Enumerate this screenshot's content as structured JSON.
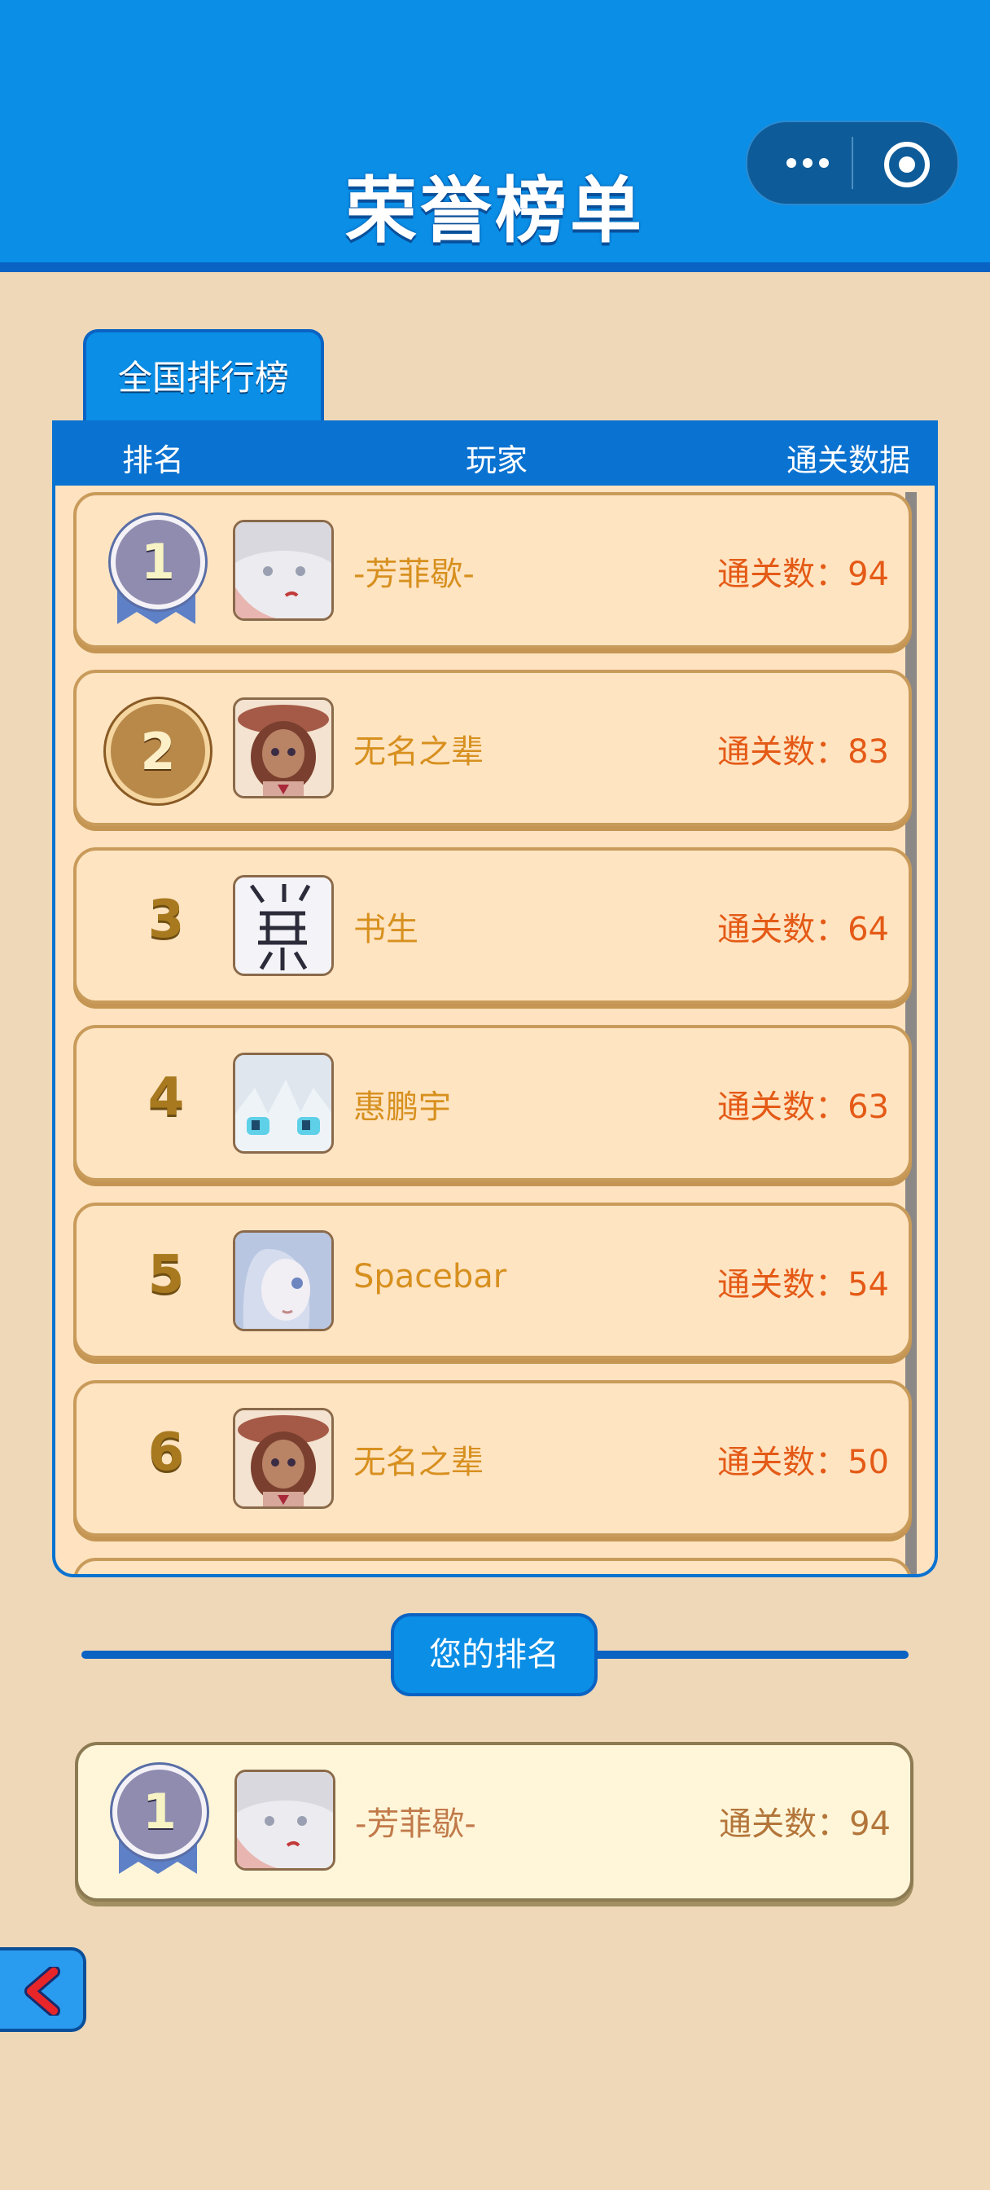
{
  "header": {
    "title": "荣誉榜单"
  },
  "tabs": [
    {
      "label": "全国排行榜"
    }
  ],
  "columns": {
    "rank": "排名",
    "player": "玩家",
    "data": "通关数据"
  },
  "leaderboard": [
    {
      "rank": "1",
      "name": "-芳菲歇-",
      "score": "通关数：94",
      "medal": "silver-ribbon-medal",
      "avatar": "avatar-white-hair"
    },
    {
      "rank": "2",
      "name": "无名之辈",
      "score": "通关数：83",
      "medal": "bronze-medal",
      "avatar": "avatar-girl-hat"
    },
    {
      "rank": "3",
      "name": "书生",
      "score": "通关数：64",
      "avatar": "avatar-calligraphy"
    },
    {
      "rank": "4",
      "name": "惠鹏宇",
      "score": "通关数：63",
      "avatar": "avatar-blue-eyes"
    },
    {
      "rank": "5",
      "name": "Spacebar",
      "score": "通关数：54",
      "avatar": "avatar-pale-girl"
    },
    {
      "rank": "6",
      "name": "无名之辈",
      "score": "通关数：50",
      "avatar": "avatar-girl-hat"
    }
  ],
  "my_rank_section": {
    "label": "您的排名",
    "entry": {
      "rank": "1",
      "name": "-芳菲歇-",
      "score": "通关数：94",
      "medal": "silver-ribbon-medal",
      "avatar": "avatar-white-hair"
    }
  },
  "colors": {
    "primary": "#0a8ee6",
    "primary_dark": "#0a63c2",
    "background": "#efd8b8",
    "score": "#e45a16",
    "name": "#d7901f"
  }
}
